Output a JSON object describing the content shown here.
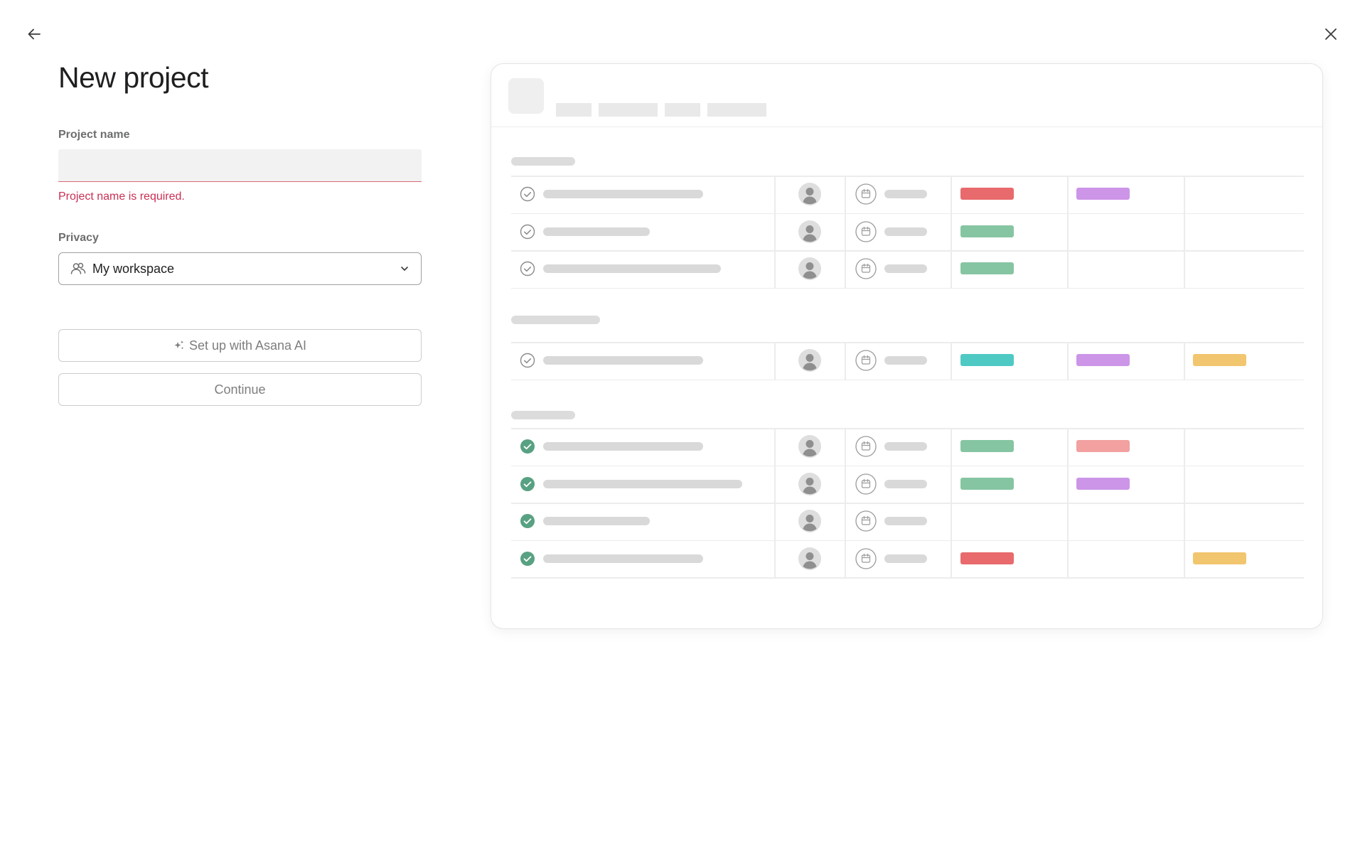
{
  "form": {
    "title": "New project",
    "project_name_label": "Project name",
    "project_name_value": "",
    "project_name_error": "Project name is required.",
    "privacy_label": "Privacy",
    "privacy_value": "My workspace",
    "ai_button_label": "Set up with Asana AI",
    "continue_button_label": "Continue"
  },
  "icons": {
    "back": "arrow-left-icon",
    "close": "close-icon",
    "privacy": "people-icon",
    "dropdown": "chevron-down-icon",
    "ai": "sparkle-icon"
  },
  "colors": {
    "error": "#c92f54",
    "chip_red": "#e86a6c",
    "chip_purple": "#cc95e8",
    "chip_green": "#86c5a2",
    "chip_teal": "#4fc9c3",
    "chip_pink": "#f2a0a0",
    "chip_orange": "#f2c56f",
    "check_done": "#58a182"
  },
  "preview": {
    "sections": [
      {
        "rows": [
          {
            "done": false,
            "chips": [
              "chip_red",
              "chip_purple",
              null
            ]
          },
          {
            "done": false,
            "chips": [
              "chip_green",
              null,
              null
            ]
          },
          {
            "done": false,
            "chips": [
              "chip_green",
              null,
              null
            ]
          }
        ]
      },
      {
        "rows": [
          {
            "done": false,
            "chips": [
              "chip_teal",
              "chip_purple",
              "chip_orange"
            ]
          }
        ]
      },
      {
        "rows": [
          {
            "done": true,
            "chips": [
              "chip_green",
              "chip_pink",
              null
            ]
          },
          {
            "done": true,
            "chips": [
              "chip_green",
              "chip_purple",
              null
            ]
          },
          {
            "done": true,
            "chips": [
              null,
              null,
              null
            ]
          },
          {
            "done": true,
            "chips": [
              "chip_red",
              null,
              "chip_orange"
            ]
          }
        ]
      }
    ]
  }
}
